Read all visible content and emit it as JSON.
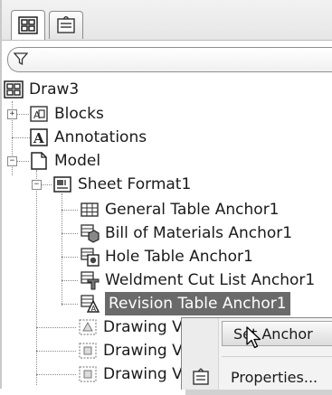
{
  "tabs": [
    {
      "icon": "feature-manager-icon",
      "active": true
    },
    {
      "icon": "property-manager-icon",
      "active": false
    }
  ],
  "filter": {
    "icon": "filter-icon"
  },
  "tree": {
    "root": "Draw3",
    "blocks": "Blocks",
    "annotations": "Annotations",
    "model": "Model",
    "sheet_format": "Sheet Format1",
    "anchors": [
      "General Table Anchor1",
      "Bill of Materials Anchor1",
      "Hole Table Anchor1",
      "Weldment Cut List Anchor1",
      "Revision Table Anchor1"
    ],
    "drawing_views": [
      "Drawing Vi",
      "Drawing Vi",
      "Drawing Vi"
    ],
    "expanders": {
      "blocks": "+",
      "model": "−",
      "sheet_format": "−"
    }
  },
  "context_menu": {
    "set_anchor": "Set Anchor",
    "properties": "Properties..."
  },
  "colors": {
    "selection": "#6a6a6a",
    "menu_bg": "#f3f3f3"
  }
}
